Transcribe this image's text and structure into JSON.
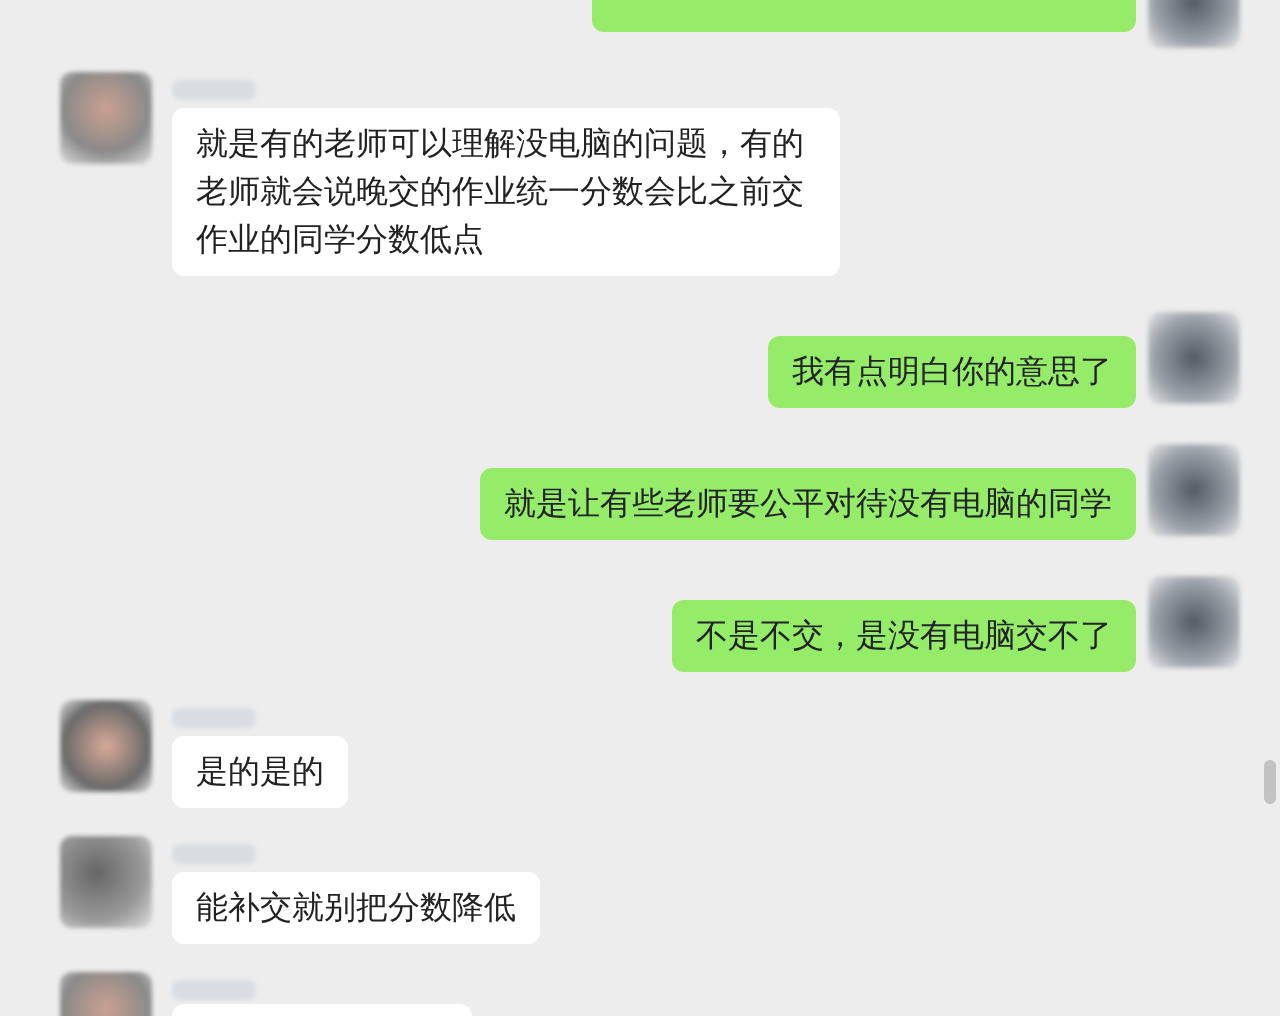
{
  "messages": [
    {
      "kind": "sent_cut"
    },
    {
      "kind": "received",
      "text": "就是有的老师可以理解没电脑的问题，有的老师就会说晚交的作业统一分数会比之前交作业的同学分数低点"
    },
    {
      "kind": "sent",
      "text": "我有点明白你的意思了"
    },
    {
      "kind": "sent",
      "text": "就是让有些老师要公平对待没有电脑的同学"
    },
    {
      "kind": "sent",
      "text": "不是不交，是没有电脑交不了"
    },
    {
      "kind": "received",
      "text": "是的是的"
    },
    {
      "kind": "received",
      "text": "能补交就别把分数降低"
    },
    {
      "kind": "received_cut"
    }
  ]
}
